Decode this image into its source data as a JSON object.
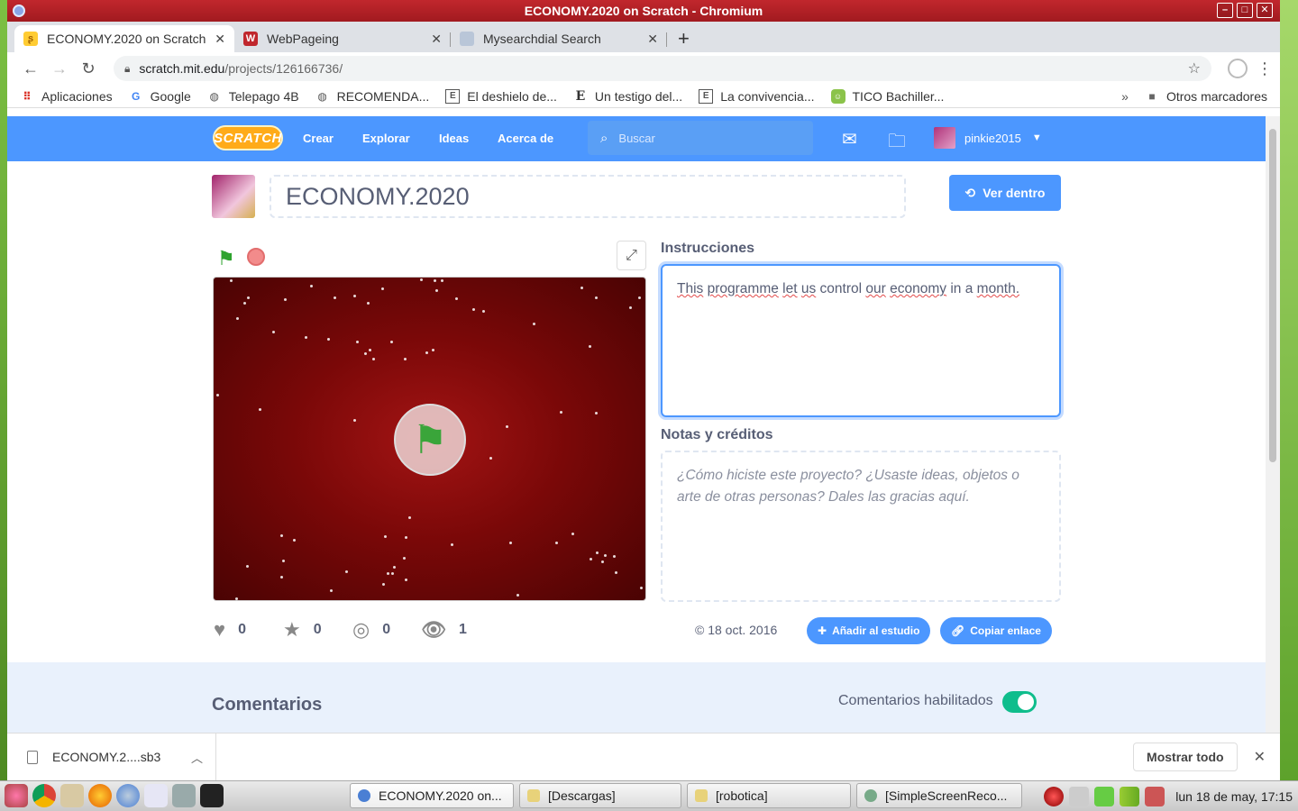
{
  "window": {
    "title": "ECONOMY.2020 on Scratch - Chromium",
    "buttons": [
      "–",
      "□",
      "✕"
    ]
  },
  "tabs": [
    {
      "label": "ECONOMY.2020 on Scratch",
      "icon": "scratch-cat-icon",
      "active": true
    },
    {
      "label": "WebPageing",
      "icon": "w-logo-icon",
      "active": false
    },
    {
      "label": "Mysearchdial Search",
      "icon": "search-engine-icon",
      "active": false
    }
  ],
  "newtab_label": "+",
  "address": {
    "host": "scratch.mit.edu",
    "path": "/projects/126166736/"
  },
  "bookmarks": [
    {
      "label": "Aplicaciones",
      "icon": "apps-grid-icon"
    },
    {
      "label": "Google",
      "icon": "google-icon"
    },
    {
      "label": "Telepago 4B",
      "icon": "globe-icon"
    },
    {
      "label": "RECOMENDA...",
      "icon": "globe-icon"
    },
    {
      "label": "El deshielo de...",
      "icon": "e-square-icon"
    },
    {
      "label": "Un testigo del...",
      "icon": "e-bold-icon"
    },
    {
      "label": "La convivencia...",
      "icon": "e-square-icon"
    },
    {
      "label": "TICO Bachiller...",
      "icon": "tico-icon"
    }
  ],
  "bookmarks_more": "»",
  "bookmarks_other": "Otros marcadores",
  "scratch_nav": {
    "logo": "SCRATCH",
    "links": [
      "Crear",
      "Explorar",
      "Ideas",
      "Acerca de"
    ],
    "search_placeholder": "Buscar",
    "username": "pinkie2015"
  },
  "project": {
    "title": "ECONOMY.2020",
    "see_inside": "Ver dentro",
    "instructions_label": "Instrucciones",
    "instructions_words": [
      "This",
      "programme",
      "let",
      "us",
      "control",
      "our",
      "economy",
      "in",
      "a",
      "month."
    ],
    "notes_label": "Notas y créditos",
    "notes_placeholder": "¿Cómo hiciste este proyecto? ¿Usaste ideas, objetos o arte de otras personas? Dales las gracias aquí.",
    "stats": {
      "loves": "0",
      "favorites": "0",
      "remixes": "0",
      "views": "1"
    },
    "date": "© 18 oct. 2016",
    "add_studio": "Añadir al estudio",
    "copy_link": "Copiar enlace"
  },
  "comments": {
    "title": "Comentarios",
    "enabled_label": "Comentarios habilitados",
    "enabled": true
  },
  "downloads": {
    "file": "ECONOMY.2....sb3",
    "show_all": "Mostrar todo"
  },
  "taskbar": {
    "tasks": [
      {
        "label": "ECONOMY.2020 on...",
        "active": true
      },
      {
        "label": "[Descargas]",
        "active": false
      },
      {
        "label": "[robotica]",
        "active": false
      },
      {
        "label": "[SimpleScreenReco...",
        "active": false
      }
    ],
    "clock": "lun 18 de may, 17:15"
  },
  "colors": {
    "scratch_blue": "#4c97ff",
    "title_bar_red": "#c1272d",
    "toggle_green": "#0fbd8c"
  }
}
